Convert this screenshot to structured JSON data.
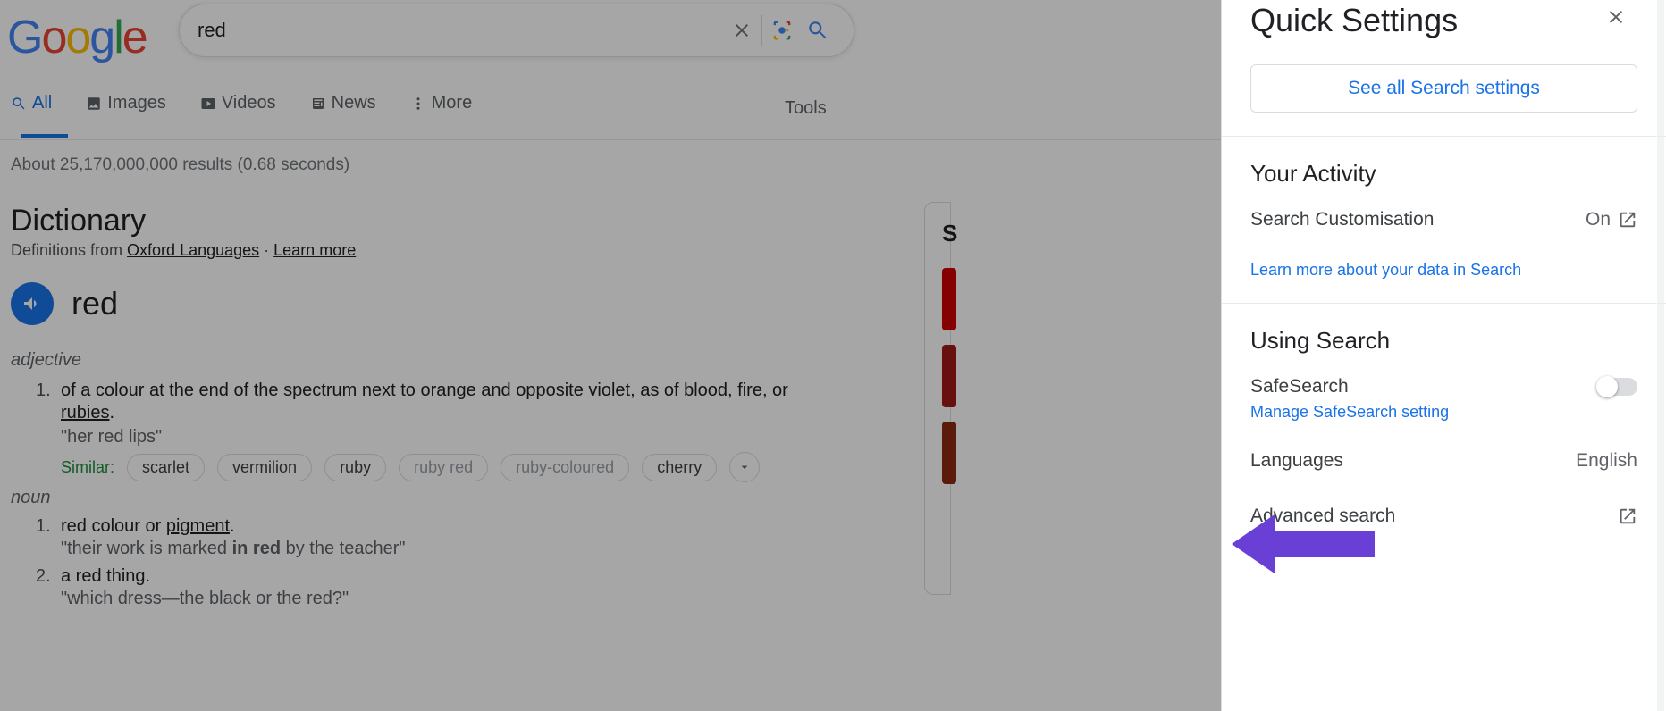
{
  "search": {
    "query": "red"
  },
  "tabs": {
    "all": "All",
    "images": "Images",
    "videos": "Videos",
    "news": "News",
    "more": "More",
    "tools": "Tools"
  },
  "stats": "About 25,170,000,000 results (0.68 seconds)",
  "dictionary": {
    "title": "Dictionary",
    "subPrefix": "Definitions from ",
    "source": "Oxford Languages",
    "dot": " · ",
    "learn": "Learn more",
    "word": "red",
    "pos1": "adjective",
    "def1_text": "of a colour at the end of the spectrum next to orange and opposite violet, as of blood, fire, or ",
    "def1_link": "rubies",
    "def1_period": ".",
    "def1_ex": "\"her red lips\"",
    "similar_label": "Similar:",
    "similar": [
      "scarlet",
      "vermilion",
      "ruby",
      "ruby red",
      "ruby-coloured",
      "cherry"
    ],
    "pos2": "noun",
    "noun1_prefix": "red colour or ",
    "noun1_link": "pigment",
    "noun1_period": ".",
    "noun1_ex_a": "\"their work is marked ",
    "noun1_ex_b": "in red",
    "noun1_ex_c": " by the teacher\"",
    "noun2": "a red thing.",
    "noun2_ex": "\"which dress—the black or the red?\""
  },
  "sideInitial": "S",
  "panel": {
    "title": "Quick Settings",
    "seeAll": "See all Search settings",
    "activity": {
      "title": "Your Activity",
      "custom_label": "Search Customisation",
      "custom_value": "On",
      "learn": "Learn more about your data in Search"
    },
    "using": {
      "title": "Using Search",
      "safesearch": "SafeSearch",
      "manage": "Manage SafeSearch setting",
      "lang_label": "Languages",
      "lang_value": "English",
      "advanced": "Advanced search"
    }
  }
}
